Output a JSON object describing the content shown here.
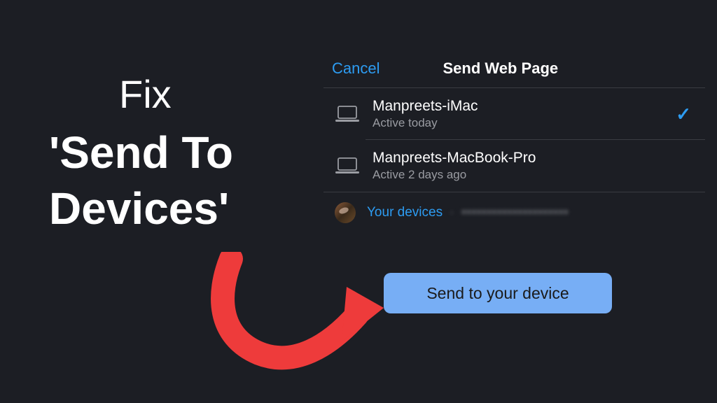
{
  "headline": {
    "line1": "Fix",
    "line2": "'Send To",
    "line3": "Devices'"
  },
  "panel": {
    "cancel_label": "Cancel",
    "title": "Send Web Page",
    "devices": [
      {
        "name": "Manpreets-iMac",
        "status": "Active today",
        "selected": true
      },
      {
        "name": "Manpreets-MacBook-Pro",
        "status": "Active 2 days ago",
        "selected": false
      }
    ],
    "account": {
      "label": "Your devices",
      "separator": " · ",
      "email_obscured": "•••••••••••••••••••••"
    }
  },
  "send_button": {
    "label": "Send to your device"
  }
}
